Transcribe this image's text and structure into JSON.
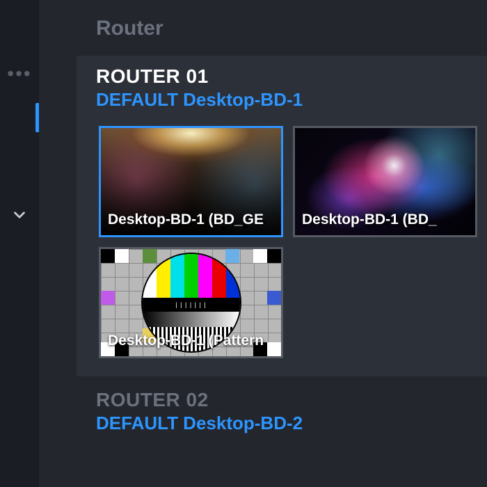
{
  "panel": {
    "title": "Router"
  },
  "sidebar": {
    "more_icon": "more-horizontal",
    "expand_icon": "chevron-down"
  },
  "routers": [
    {
      "name": "ROUTER 01",
      "subtitle": "DEFAULT Desktop-BD-1",
      "sources": [
        {
          "label": "Desktop-BD-1 (BD_GE",
          "selected": true,
          "thumb_kind": "concert"
        },
        {
          "label": "Desktop-BD-1 (BD_",
          "selected": false,
          "thumb_kind": "galaxy"
        },
        {
          "label": "Desktop-BD-1 (Pattern",
          "selected": false,
          "thumb_kind": "testpattern"
        }
      ]
    },
    {
      "name": "ROUTER 02",
      "subtitle": "DEFAULT Desktop-BD-2",
      "sources": []
    }
  ],
  "colors": {
    "accent": "#2d95ff",
    "bg": "#1a1d23",
    "panel": "#2c3038"
  }
}
